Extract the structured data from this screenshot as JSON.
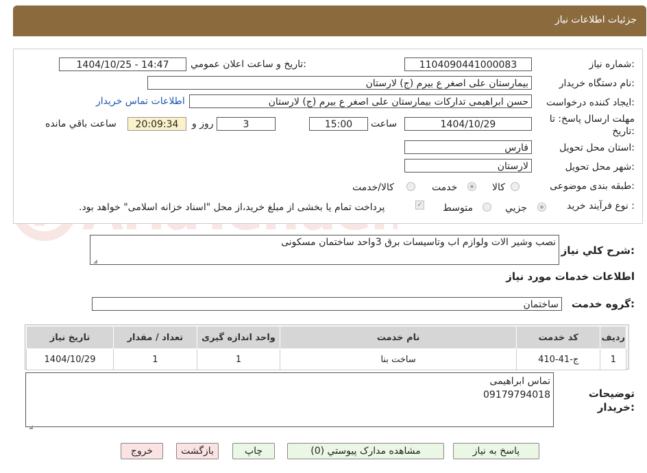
{
  "header": {
    "title": "جزئیات اطلاعات نیاز"
  },
  "form": {
    "need_number_label": "شماره نیاز:",
    "need_number": "1104090441000083",
    "announce_label": "تاریخ و ساعت اعلان عمومي:",
    "announce_value": "1404/10/25 - 14:47",
    "buyer_org_label": "نام دستگاه خریدار:",
    "buyer_org": "بیمارستان علی اصغر  ع  بیرم (ج) لارستان",
    "requester_label": "ایجاد کننده درخواست:",
    "requester": "حسن ابراهیمی تدارکات بیمارستان علی اصغر  ع  بیرم (ج) لارستان",
    "buyer_contact_link": "اطلاعات تماس خریدار",
    "deadline_label": "مهلت ارسال پاسخ: تا تاريخ:",
    "deadline_date": "1404/10/29",
    "time_label": "ساعت",
    "deadline_time": "15:00",
    "days_value": "3",
    "days_label": "روز و",
    "remaining_time": "20:09:34",
    "remaining_label": "ساعت باقي مانده",
    "province_label": "استان محل تحویل:",
    "province": "فارس",
    "city_label": "شهر محل تحویل:",
    "city": "لارستان",
    "category_label": "طبقه بندی موضوعی:",
    "category_options": [
      "کالا",
      "خدمت",
      "کالا/خدمت"
    ],
    "category_selected": "خدمت",
    "process_label": "نوع فرآیند خرید :",
    "process_options": [
      "جزيي",
      "متوسط"
    ],
    "process_selected": "جزيي",
    "payment_note": "پرداخت تمام یا بخشی از مبلغ خرید،از محل \"اسناد خزانه اسلامی\" خواهد بود."
  },
  "description": {
    "label": "شرح کلي نياز:",
    "value": "نصب وشیر الات ولوازم اب وتاسیسات برق 3واحد ساختمان مسکونی"
  },
  "services_section_title": "اطلاعات خدمات مورد نياز",
  "service_group": {
    "label": "گروه خدمت:",
    "value": "ساختمان"
  },
  "table": {
    "headers": [
      "ردیف",
      "کد خدمت",
      "نام خدمت",
      "واحد اندازه گیری",
      "تعداد / مقدار",
      "تاریخ نیاز"
    ],
    "rows": [
      [
        "1",
        "ج-41-410",
        "ساخت بنا",
        "1",
        "1",
        "1404/10/29"
      ]
    ]
  },
  "buyer_notes": {
    "label": "توضیحات خریدار:",
    "line1": "تماس ابراهیمی",
    "line2": "09179794018"
  },
  "buttons": {
    "reply": "پاسخ به نیاز",
    "attachments": "مشاهده مدارک پیوستي (0)",
    "print": "چاپ",
    "back": "بازگشت",
    "exit": "خروج"
  },
  "watermark": {
    "text": "AriaTender.neT"
  },
  "colors": {
    "header": "#8b6a3e",
    "link": "#1a55b3",
    "button_green": "#e9f7e4",
    "button_pink": "#fbe3e3",
    "remaining_bg": "#fbf2c9"
  }
}
